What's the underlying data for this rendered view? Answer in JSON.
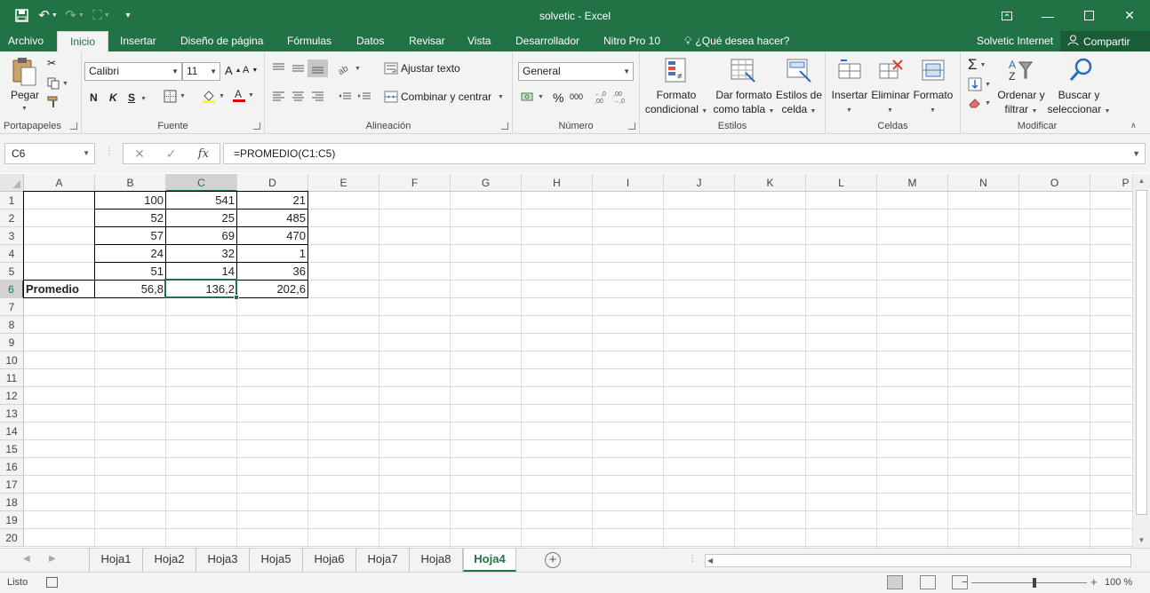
{
  "window": {
    "title": "solvetic - Excel"
  },
  "menu": {
    "tabs": [
      "Archivo",
      "Inicio",
      "Insertar",
      "Diseño de página",
      "Fórmulas",
      "Datos",
      "Revisar",
      "Vista",
      "Desarrollador",
      "Nitro Pro 10"
    ],
    "active_tab": "Inicio",
    "tell_me": "¿Qué desea hacer?",
    "user": "Solvetic Internet",
    "share": "Compartir"
  },
  "ribbon": {
    "clipboard": {
      "label": "Portapapeles",
      "paste": "Pegar"
    },
    "font": {
      "label": "Fuente",
      "name": "Calibri",
      "size": "11",
      "bold": "N",
      "italic": "K",
      "underline": "S"
    },
    "alignment": {
      "label": "Alineación",
      "wrap": "Ajustar texto",
      "merge": "Combinar y centrar"
    },
    "number": {
      "label": "Número",
      "format": "General",
      "percent": "%",
      "thousands": "000"
    },
    "styles": {
      "label": "Estilos",
      "conditional": [
        "Formato",
        "condicional"
      ],
      "table": [
        "Dar formato",
        "como tabla"
      ],
      "cell": [
        "Estilos de",
        "celda"
      ]
    },
    "cells": {
      "label": "Celdas",
      "insert": "Insertar",
      "delete": "Eliminar",
      "format": "Formato"
    },
    "editing": {
      "label": "Modificar",
      "sort": [
        "Ordenar y",
        "filtrar"
      ],
      "find": [
        "Buscar y",
        "seleccionar"
      ]
    }
  },
  "formula_bar": {
    "name_box": "C6",
    "formula": "=PROMEDIO(C1:C5)"
  },
  "grid": {
    "columns": [
      "A",
      "B",
      "C",
      "D",
      "E",
      "F",
      "G",
      "H",
      "I",
      "J",
      "K",
      "L",
      "M",
      "N",
      "O",
      "P"
    ],
    "rows": [
      "1",
      "2",
      "3",
      "4",
      "5",
      "6",
      "7",
      "8",
      "9",
      "10",
      "11",
      "12",
      "13",
      "14",
      "15",
      "16",
      "17",
      "18",
      "19",
      "20"
    ],
    "selected_column": "C",
    "selected_row": "6",
    "data": [
      [
        "",
        "100",
        "541",
        "21"
      ],
      [
        "",
        "52",
        "25",
        "485"
      ],
      [
        "",
        "57",
        "69",
        "470"
      ],
      [
        "",
        "24",
        "32",
        "1"
      ],
      [
        "",
        "51",
        "14",
        "36"
      ],
      [
        "Promedio",
        "56,8",
        "136,2",
        "202,6"
      ]
    ]
  },
  "sheets": {
    "tabs": [
      "Hoja1",
      "Hoja2",
      "Hoja3",
      "Hoja5",
      "Hoja6",
      "Hoja7",
      "Hoja8",
      "Hoja4"
    ],
    "active": "Hoja4"
  },
  "status": {
    "ready": "Listo",
    "zoom": "100 %"
  },
  "colors": {
    "brand": "#217346"
  }
}
